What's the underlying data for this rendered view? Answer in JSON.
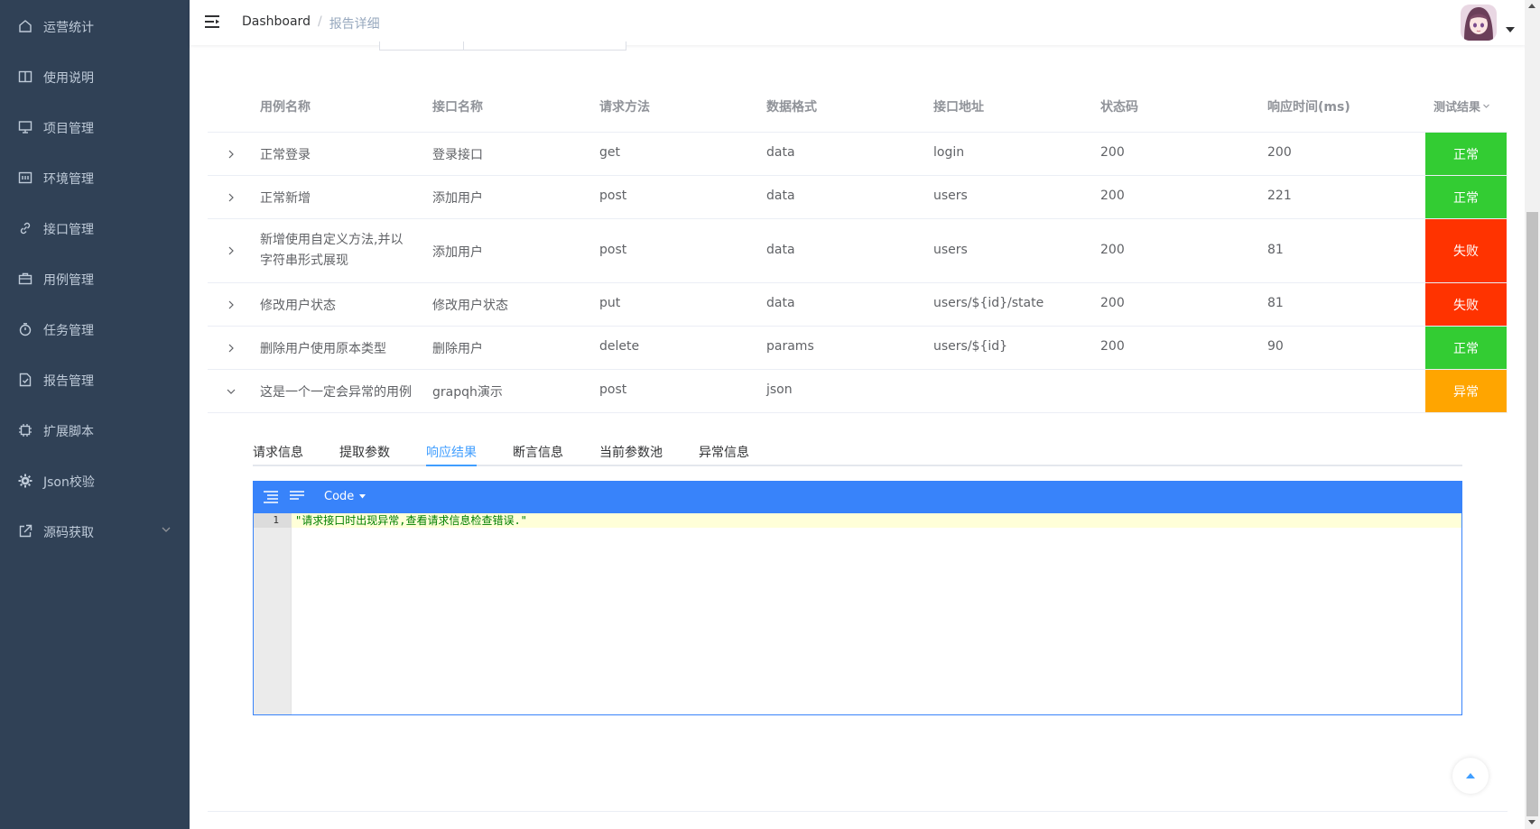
{
  "sidebar": {
    "items": [
      {
        "label": "运营统计",
        "icon": "home-icon"
      },
      {
        "label": "使用说明",
        "icon": "book-icon"
      },
      {
        "label": "项目管理",
        "icon": "monitor-icon"
      },
      {
        "label": "环境管理",
        "icon": "server-icon"
      },
      {
        "label": "接口管理",
        "icon": "link-icon"
      },
      {
        "label": "用例管理",
        "icon": "briefcase-icon"
      },
      {
        "label": "任务管理",
        "icon": "timer-icon"
      },
      {
        "label": "报告管理",
        "icon": "document-icon"
      },
      {
        "label": "扩展脚本",
        "icon": "chip-icon"
      },
      {
        "label": "Json校验",
        "icon": "gear-icon"
      },
      {
        "label": "源码获取",
        "icon": "external-link-icon"
      }
    ]
  },
  "navbar": {
    "breadcrumb": {
      "home": "Dashboard",
      "separator": "/",
      "current": "报告详细"
    }
  },
  "table": {
    "headers": [
      "用例名称",
      "接口名称",
      "请求方法",
      "数据格式",
      "接口地址",
      "状态码",
      "响应时间(ms)"
    ],
    "result_header": "测试结果",
    "rows": [
      {
        "case": "正常登录",
        "api": "登录接口",
        "method": "get",
        "format": "data",
        "path": "login",
        "code": "200",
        "time": "200",
        "result": "正常",
        "result_color": "#33cc33"
      },
      {
        "case": "正常新增",
        "api": "添加用户",
        "method": "post",
        "format": "data",
        "path": "users",
        "code": "200",
        "time": "221",
        "result": "正常",
        "result_color": "#33cc33"
      },
      {
        "case": "新增使用自定义方法,并以字符串形式展现",
        "api": "添加用户",
        "method": "post",
        "format": "data",
        "path": "users",
        "code": "200",
        "time": "81",
        "result": "失败",
        "result_color": "#ff3300"
      },
      {
        "case": "修改用户状态",
        "api": "修改用户状态",
        "method": "put",
        "format": "data",
        "path": "users/${id}/state",
        "code": "200",
        "time": "81",
        "result": "失败",
        "result_color": "#ff3300"
      },
      {
        "case": "删除用户使用原本类型",
        "api": "删除用户",
        "method": "delete",
        "format": "params",
        "path": "users/${id}",
        "code": "200",
        "time": "90",
        "result": "正常",
        "result_color": "#33cc33"
      },
      {
        "case": "这是一个一定会异常的用例",
        "api": "grapqh演示",
        "method": "post",
        "format": "json",
        "path": "",
        "code": "",
        "time": "",
        "result": "异常",
        "result_color": "#ffa500"
      }
    ]
  },
  "tabs": [
    "请求信息",
    "提取参数",
    "响应结果",
    "断言信息",
    "当前参数池",
    "异常信息"
  ],
  "active_tab": "响应结果",
  "editor": {
    "mode_label": "Code",
    "line_number": "1",
    "code": "\"请求接口时出现异常,查看请求信息检查错误.\""
  },
  "colors": {
    "sidebar_bg": "#304156",
    "accent": "#409eff",
    "editor_bar": "#3883fa"
  }
}
